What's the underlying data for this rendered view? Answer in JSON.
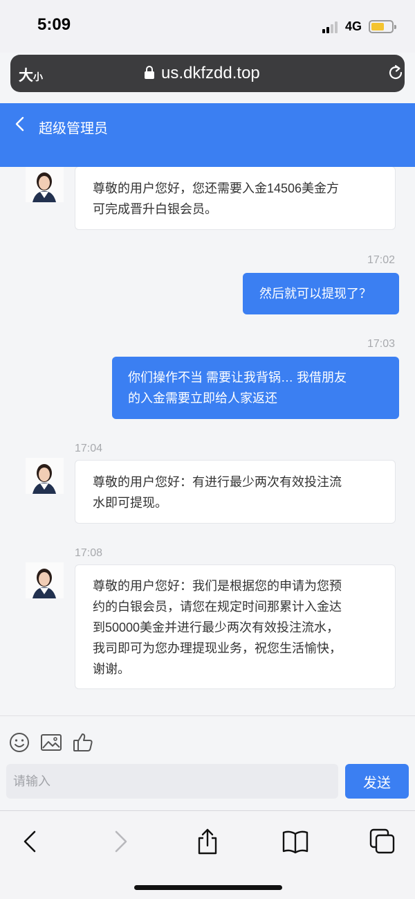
{
  "status_bar": {
    "time": "5:09",
    "network": "4G"
  },
  "browser": {
    "text_size_big": "大",
    "text_size_small": "小",
    "url": "us.dkfzdd.top"
  },
  "header": {
    "title": "超级管理员"
  },
  "messages": [
    {
      "from": "agent",
      "time": "",
      "text": "尊敬的用户您好，您还需要入金14506美金方\n可完成晋升白银会员。"
    },
    {
      "from": "user",
      "time": "17:02",
      "text": "然后就可以提现了？"
    },
    {
      "from": "user",
      "time": "17:03",
      "text": "你们操作不当 需要让我背锅… 我借朋友\n的入金需要立即给人家返还"
    },
    {
      "from": "agent",
      "time": "17:04",
      "text": "尊敬的用户您好：有进行最少两次有效投注流\n水即可提现。"
    },
    {
      "from": "agent",
      "time": "17:08",
      "text": "尊敬的用户您好：我们是根据您的申请为您预\n约的白银会员，请您在规定时间那累计入金达\n到50000美金并进行最少两次有效投注流水，\n我司即可为您办理提现业务，祝您生活愉快，\n谢谢。"
    }
  ],
  "composer": {
    "placeholder": "请输入",
    "send_label": "发送"
  },
  "colors": {
    "accent": "#3b7ff2",
    "background": "#f4f5f7"
  }
}
